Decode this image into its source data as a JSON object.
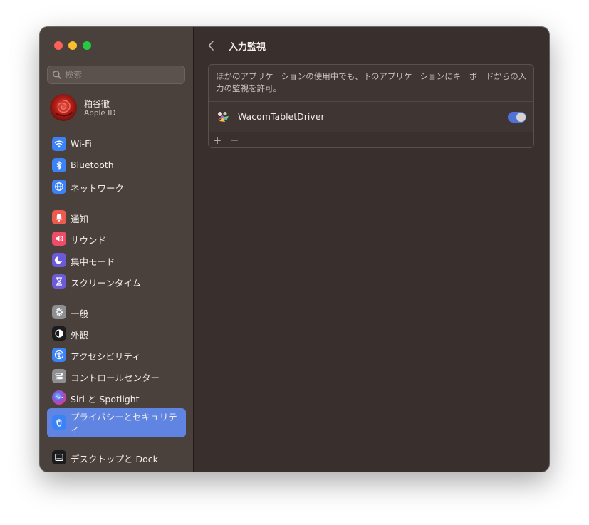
{
  "search": {
    "placeholder": "検索"
  },
  "account": {
    "name": "粕谷徹",
    "subtitle": "Apple ID"
  },
  "sidebar": {
    "items": [
      {
        "label": "Wi-Fi",
        "icon": "wifi-icon",
        "color": "#3b82f6"
      },
      {
        "label": "Bluetooth",
        "icon": "bluetooth-icon",
        "color": "#3b82f6"
      },
      {
        "label": "ネットワーク",
        "icon": "globe-icon",
        "color": "#3b82f6"
      },
      {
        "label": "通知",
        "icon": "bell-icon",
        "color": "#ef5a4f"
      },
      {
        "label": "サウンド",
        "icon": "speaker-icon",
        "color": "#ef4c6a"
      },
      {
        "label": "集中モード",
        "icon": "moon-icon",
        "color": "#6c5bd8"
      },
      {
        "label": "スクリーンタイム",
        "icon": "hourglass-icon",
        "color": "#6c5bd8"
      },
      {
        "label": "一般",
        "icon": "gear-icon",
        "color": "#8e8e93"
      },
      {
        "label": "外観",
        "icon": "appearance-icon",
        "color": "#1c1c1e"
      },
      {
        "label": "アクセシビリティ",
        "icon": "accessibility-icon",
        "color": "#3b82f6"
      },
      {
        "label": "コントロールセンター",
        "icon": "control-center-icon",
        "color": "#8e8e93"
      },
      {
        "label": "Siri と Spotlight",
        "icon": "siri-icon",
        "color": "#5a3fb0"
      },
      {
        "label": "プライバシーとセキュリティ",
        "icon": "hand-icon",
        "color": "#3b82f6",
        "selected": true
      },
      {
        "label": "デスクトップと Dock",
        "icon": "dock-icon",
        "color": "#1c1c1e"
      }
    ]
  },
  "main": {
    "back_icon": "chevron-left-icon",
    "title": "入力監視",
    "description": "ほかのアプリケーションの使用中でも、下のアプリケーションにキーボードからの入力の監視を許可。",
    "apps": [
      {
        "name": "WacomTabletDriver",
        "enabled": true
      }
    ],
    "add_label": "+",
    "remove_label": "−"
  },
  "colors": {
    "accent": "#5f84e1",
    "toggle_on": "#4f72d9"
  }
}
